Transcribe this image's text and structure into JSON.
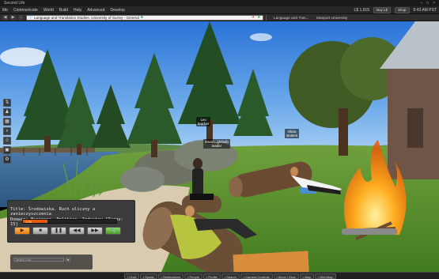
{
  "window": {
    "title": "Second Life",
    "controls": [
      "–",
      "□",
      "×"
    ]
  },
  "menubar": {
    "items": [
      "Me",
      "Communicate",
      "World",
      "Build",
      "Help",
      "Advanced",
      "Develop"
    ],
    "balance": "L$ 1,915",
    "buy_label": "Buy L$",
    "shop_label": "Shop",
    "time": "5:43 AM PST"
  },
  "navbar": {
    "location": "Language and Translation Studies, University of Surrey - General",
    "favorites": [
      "Language and Tran...",
      "Stanport University"
    ]
  },
  "nametags": {
    "avatar1": {
      "name": "Leo",
      "status": "teacher"
    },
    "avatar2": {
      "name": "David Lightbulb",
      "status": "reader"
    },
    "avatar3": {
      "name": "Olivia",
      "status": "student"
    }
  },
  "media": {
    "title_line1": "Title: Środowiska. Ruch uliczny a zanieczyszczenia",
    "title_line2": "Domain: Business, Politics, Industry [Turns: 15]",
    "time": "1:25",
    "progress": 0.26
  },
  "chat": {
    "placeholder": "Nearby chat"
  },
  "bottombar": {
    "buttons": [
      "Chat",
      "Speak",
      "Destinations",
      "People",
      "Profile",
      "Search",
      "Camera Controls",
      "Move / View",
      "Map",
      "Mini-Map"
    ]
  },
  "colors": {
    "media_progress": "#e85a0a",
    "play_button": "#e77d12",
    "tools_button": "#4c9a2d"
  }
}
